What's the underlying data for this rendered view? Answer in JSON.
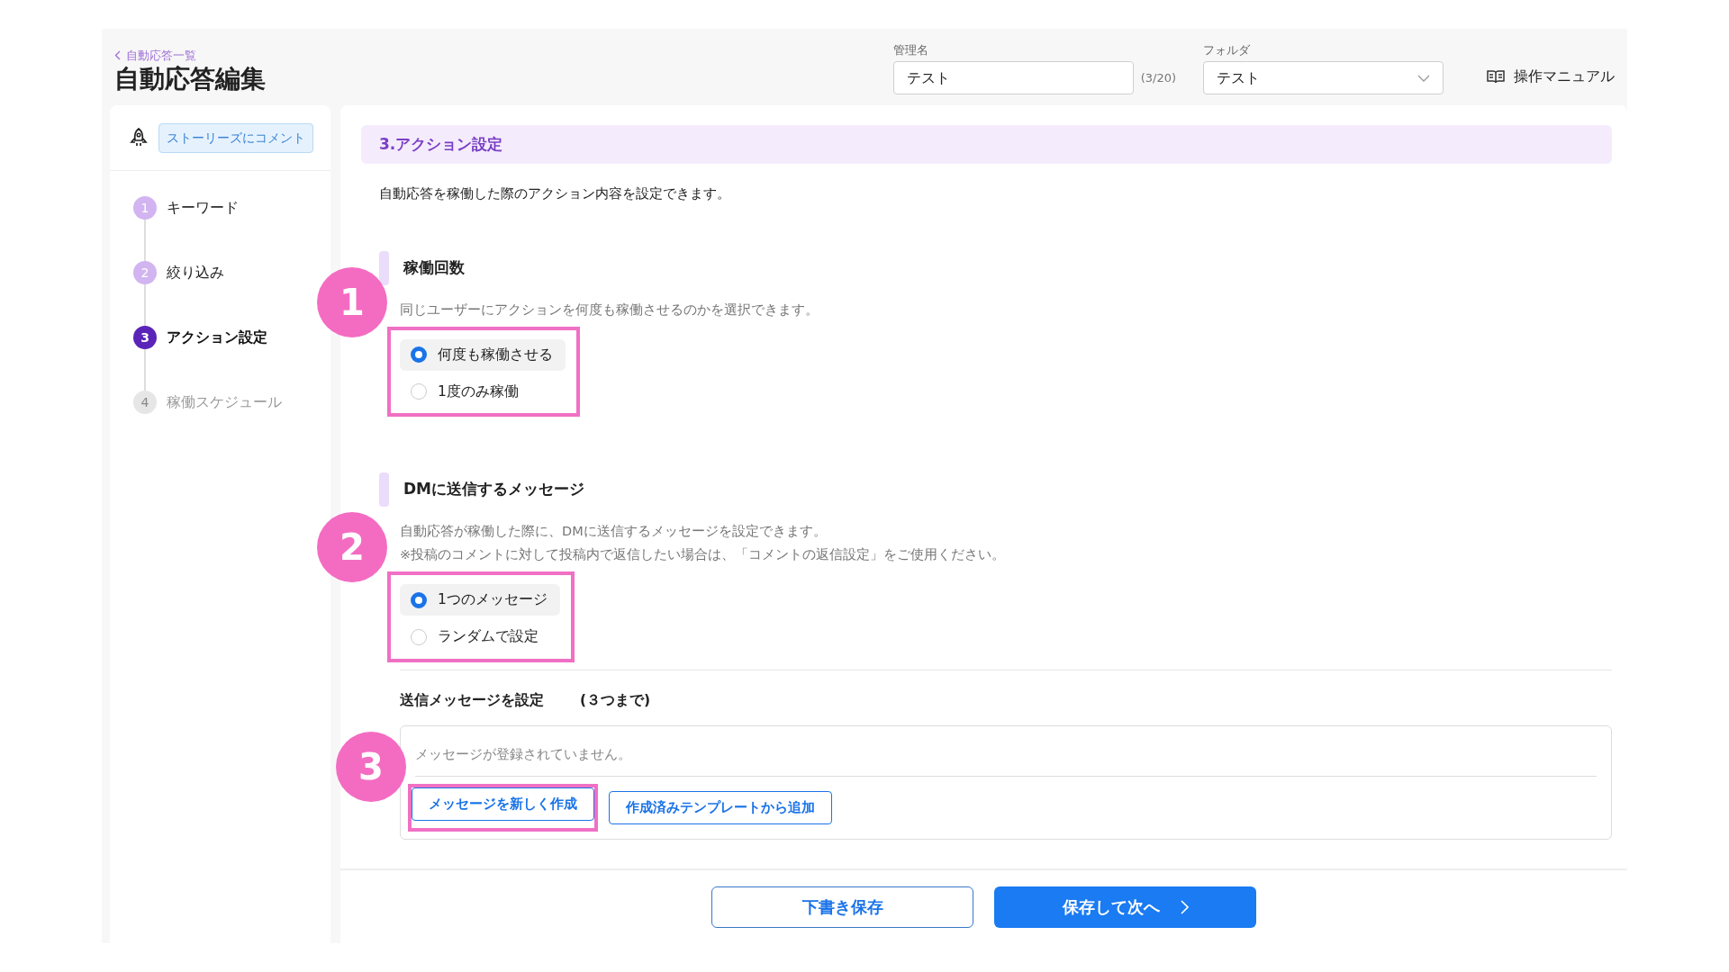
{
  "breadcrumb": {
    "label": "自動応答一覧"
  },
  "page_title": "自動応答編集",
  "fields": [
    {
      "kind": "text",
      "label": "管理名",
      "value": "テスト",
      "counter": "(3/20)"
    },
    {
      "kind": "select",
      "label": "フォルダ",
      "value": "テスト"
    }
  ],
  "manual_link": "操作マニュアル",
  "sidebar": {
    "tag": "ストーリーズにコメント",
    "steps": [
      {
        "number": "1",
        "label": "キーワード",
        "completed": true,
        "selected": false
      },
      {
        "number": "2",
        "label": "絞り込み",
        "completed": true,
        "selected": false
      },
      {
        "number": "3",
        "label": "アクション設定",
        "completed": false,
        "selected": true
      },
      {
        "number": "4",
        "label": "稼働スケジュール",
        "completed": false,
        "selected": false
      }
    ]
  },
  "section": {
    "title": "3.アクション設定",
    "description": "自動応答を稼働した際のアクション内容を設定できます。"
  },
  "groups": [
    {
      "heading": "稼働回数",
      "help": [
        "同じユーザーにアクションを何度も稼働させるのかを選択できます。"
      ],
      "callout": "1",
      "options": [
        {
          "label": "何度も稼働させる",
          "selected": true
        },
        {
          "label": "1度のみ稼働",
          "selected": false
        }
      ]
    },
    {
      "heading": "DMに送信するメッセージ",
      "help": [
        "自動応答が稼働した際に、DMに送信するメッセージを設定できます。",
        "※投稿のコメントに対して投稿内で返信したい場合は、「コメントの返信設定」をご使用ください。"
      ],
      "callout": "2",
      "options": [
        {
          "label": "1つのメッセージ",
          "selected": true
        },
        {
          "label": "ランダムで設定",
          "selected": false
        }
      ]
    }
  ],
  "messages": {
    "heading": "送信メッセージを設定",
    "limit": "(３つまで)",
    "empty_text": "メッセージが登録されていません。",
    "buttons": [
      {
        "label": "メッセージを新しく作成",
        "callout": "3"
      },
      {
        "label": "作成済みテンプレートから追加"
      }
    ]
  },
  "footer": {
    "buttons": [
      {
        "kind": "outline",
        "label": "下書き保存"
      },
      {
        "kind": "primary",
        "label": "保存して次へ"
      }
    ]
  }
}
